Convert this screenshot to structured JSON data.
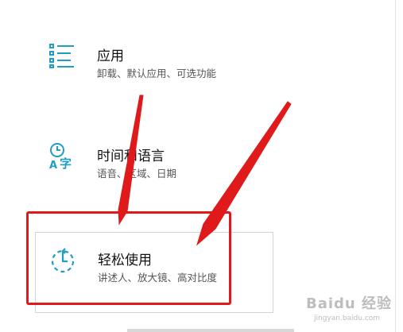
{
  "settings": {
    "tiles": [
      {
        "id": "apps",
        "icon": "apps-list-icon",
        "title": "应用",
        "subtitle": "卸载、默认应用、可选功能"
      },
      {
        "id": "time-language",
        "icon": "time-language-icon",
        "title": "时间和语言",
        "subtitle": "语音、区域、日期"
      },
      {
        "id": "ease-of-access",
        "icon": "ease-of-access-icon",
        "title": "轻松使用",
        "subtitle": "讲述人、放大镜、高对比度"
      }
    ]
  },
  "annotation": {
    "color": "#e01a1a"
  },
  "colors": {
    "accent": "#1e9ec3"
  },
  "watermark": {
    "text": "Baidu 经验",
    "sub": "jingyan.baidu.com"
  }
}
